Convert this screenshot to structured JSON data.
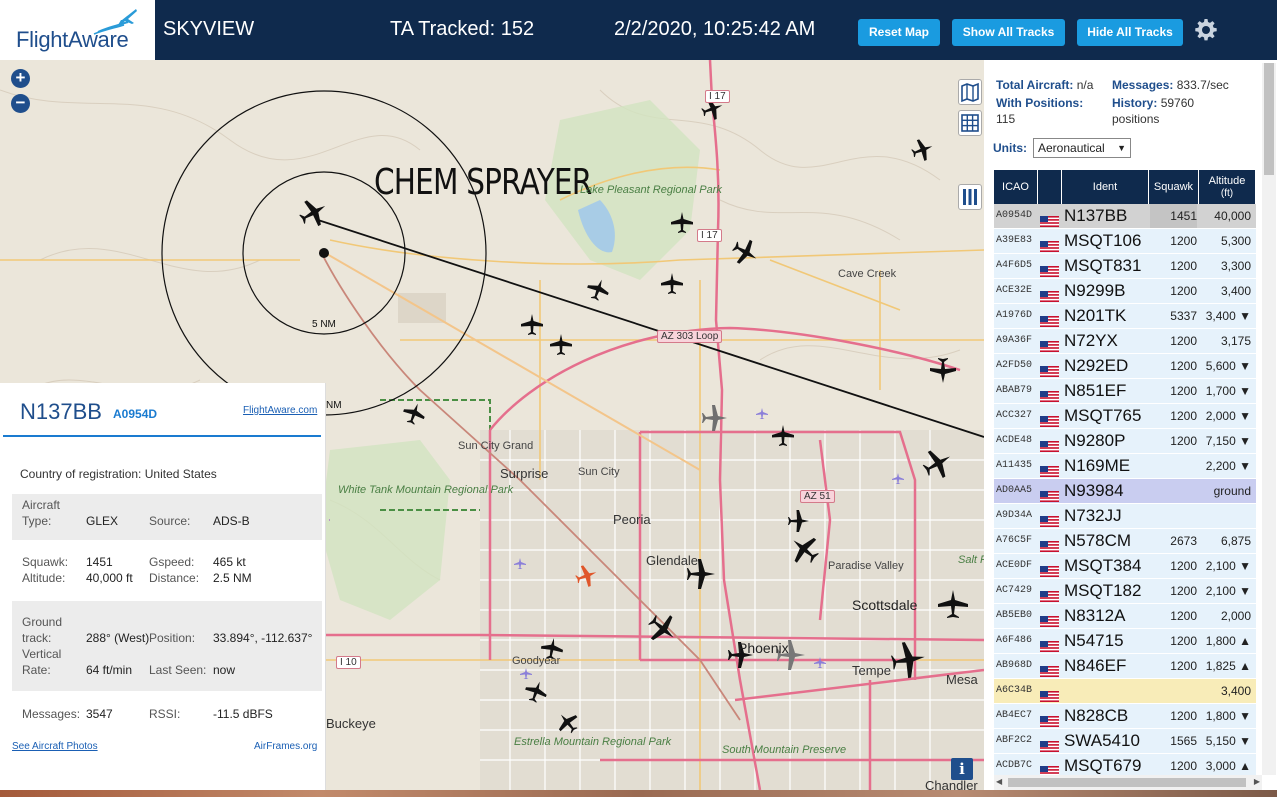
{
  "header": {
    "logo": "FlightAware",
    "site_name": "SKYVIEW",
    "tracked": "TA Tracked: 152",
    "datetime": "2/2/2020, 10:25:42 AM",
    "buttons": {
      "reset": "Reset Map",
      "show_all": "Show All Tracks",
      "hide_all": "Hide All Tracks"
    }
  },
  "map": {
    "annotation": "CHEM SPRAYER",
    "range_label": "5 NM",
    "range_label_2": "NM",
    "labels": {
      "lake_park": "Lake Pleasant Regional Park",
      "cave_creek": "Cave Creek",
      "sun_city_grand": "Sun City Grand",
      "surprise": "Surprise",
      "sun_city": "Sun City",
      "peoria": "Peoria",
      "glendale": "Glendale",
      "paradise_valley": "Paradise Valley",
      "scottsdale": "Scottsdale",
      "white_tank": "White Tank Mountain Regional Park",
      "goodyear": "Goodyear",
      "phoenix": "Phoenix",
      "tempe": "Tempe",
      "mesa": "Mesa",
      "buckeye": "Buckeye",
      "estrella": "Estrella Mountain Regional Park",
      "south_mountain": "South Mountain Preserve",
      "chandler": "Chandler",
      "salt": "Salt Rive"
    },
    "shields": {
      "i17_top": "I 17",
      "i17_mid": "I 17",
      "az303": "AZ 303 Loop",
      "az51": "AZ 51",
      "i10": "I 10"
    }
  },
  "info": {
    "ident": "N137BB",
    "icao": "A0954D",
    "fa_link": "FlightAware.com",
    "country_label": "Country of registration:",
    "country": "United States",
    "aircraft_type_label_1": "Aircraft",
    "aircraft_type_label_2": "Type:",
    "aircraft_type": "GLEX",
    "source_label": "Source:",
    "source": "ADS-B",
    "squawk_label": "Squawk:",
    "squawk": "1451",
    "gspeed_label": "Gspeed:",
    "gspeed": "465 kt",
    "altitude_label": "Altitude:",
    "altitude": "40,000 ft",
    "distance_label": "Distance:",
    "distance": "2.5 NM",
    "track_label_1": "Ground",
    "track_label_2": "track:",
    "track": "288° (West)",
    "position_label": "Position:",
    "position": "33.894°, -112.637°",
    "vrate_label_1": "Vertical",
    "vrate_label_2": "Rate:",
    "vrate": "64 ft/min",
    "last_seen_label": "Last Seen:",
    "last_seen": "now",
    "messages_label": "Messages:",
    "messages": "3547",
    "rssi_label": "RSSI:",
    "rssi": "-11.5 dBFS",
    "photos_link": "See Aircraft Photos",
    "airframes_link": "AirFrames.org"
  },
  "stats": {
    "total_label": "Total Aircraft:",
    "total": "n/a",
    "messages_label": "Messages:",
    "messages": "833.7/sec",
    "positions_label": "With Positions:",
    "positions": "115",
    "history_label": "History:",
    "history": "59760 positions",
    "units_label": "Units:",
    "units_value": "Aeronautical"
  },
  "table": {
    "headers": {
      "icao": "ICAO",
      "ident": "Ident",
      "squawk": "Squawk",
      "alt_1": "Altitude",
      "alt_2": "(ft)"
    },
    "rows": [
      {
        "icao": "A0954D",
        "ident": "N137BB",
        "squawk": "1451",
        "alt": "40,000",
        "state": "sel"
      },
      {
        "icao": "A39E83",
        "ident": "MSQT106",
        "squawk": "1200",
        "alt": "5,300",
        "state": ""
      },
      {
        "icao": "A4F6D5",
        "ident": "MSQT831",
        "squawk": "1200",
        "alt": "3,300",
        "state": ""
      },
      {
        "icao": "ACE32E",
        "ident": "N9299B",
        "squawk": "1200",
        "alt": "3,400",
        "state": ""
      },
      {
        "icao": "A1976D",
        "ident": "N201TK",
        "squawk": "5337",
        "alt": "3,400 ▼",
        "state": ""
      },
      {
        "icao": "A9A36F",
        "ident": "N72YX",
        "squawk": "1200",
        "alt": "3,175",
        "state": ""
      },
      {
        "icao": "A2FD50",
        "ident": "N292ED",
        "squawk": "1200",
        "alt": "5,600 ▼",
        "state": ""
      },
      {
        "icao": "ABAB79",
        "ident": "N851EF",
        "squawk": "1200",
        "alt": "1,700 ▼",
        "state": ""
      },
      {
        "icao": "ACC327",
        "ident": "MSQT765",
        "squawk": "1200",
        "alt": "2,000 ▼",
        "state": ""
      },
      {
        "icao": "ACDE48",
        "ident": "N9280P",
        "squawk": "1200",
        "alt": "7,150 ▼",
        "state": ""
      },
      {
        "icao": "A11435",
        "ident": "N169ME",
        "squawk": "",
        "alt": "2,200 ▼",
        "state": ""
      },
      {
        "icao": "AD0AA5",
        "ident": "N93984",
        "squawk": "",
        "alt": "ground",
        "state": "gnd"
      },
      {
        "icao": "A9D34A",
        "ident": "N732JJ",
        "squawk": "",
        "alt": "",
        "state": ""
      },
      {
        "icao": "A76C5F",
        "ident": "N578CM",
        "squawk": "2673",
        "alt": "6,875",
        "state": ""
      },
      {
        "icao": "ACE0DF",
        "ident": "MSQT384",
        "squawk": "1200",
        "alt": "2,100 ▼",
        "state": ""
      },
      {
        "icao": "AC7429",
        "ident": "MSQT182",
        "squawk": "1200",
        "alt": "2,100 ▼",
        "state": ""
      },
      {
        "icao": "AB5EB0",
        "ident": "N8312A",
        "squawk": "1200",
        "alt": "2,000",
        "state": ""
      },
      {
        "icao": "A6F486",
        "ident": "N54715",
        "squawk": "1200",
        "alt": "1,800 ▲",
        "state": ""
      },
      {
        "icao": "AB968D",
        "ident": "N846EF",
        "squawk": "1200",
        "alt": "1,825 ▲",
        "state": ""
      },
      {
        "icao": "A6C34B",
        "ident": "",
        "squawk": "",
        "alt": "3,400",
        "state": "emg"
      },
      {
        "icao": "AB4EC7",
        "ident": "N828CB",
        "squawk": "1200",
        "alt": "1,800 ▼",
        "state": ""
      },
      {
        "icao": "ABF2C2",
        "ident": "SWA5410",
        "squawk": "1565",
        "alt": "5,150 ▼",
        "state": ""
      },
      {
        "icao": "ACDB7C",
        "ident": "MSQT679",
        "squawk": "1200",
        "alt": "3,000 ▲",
        "state": ""
      }
    ]
  },
  "colors": {
    "header_bg": "#0f2a4d",
    "button": "#1a9be0",
    "accent": "#1f4e8c"
  }
}
